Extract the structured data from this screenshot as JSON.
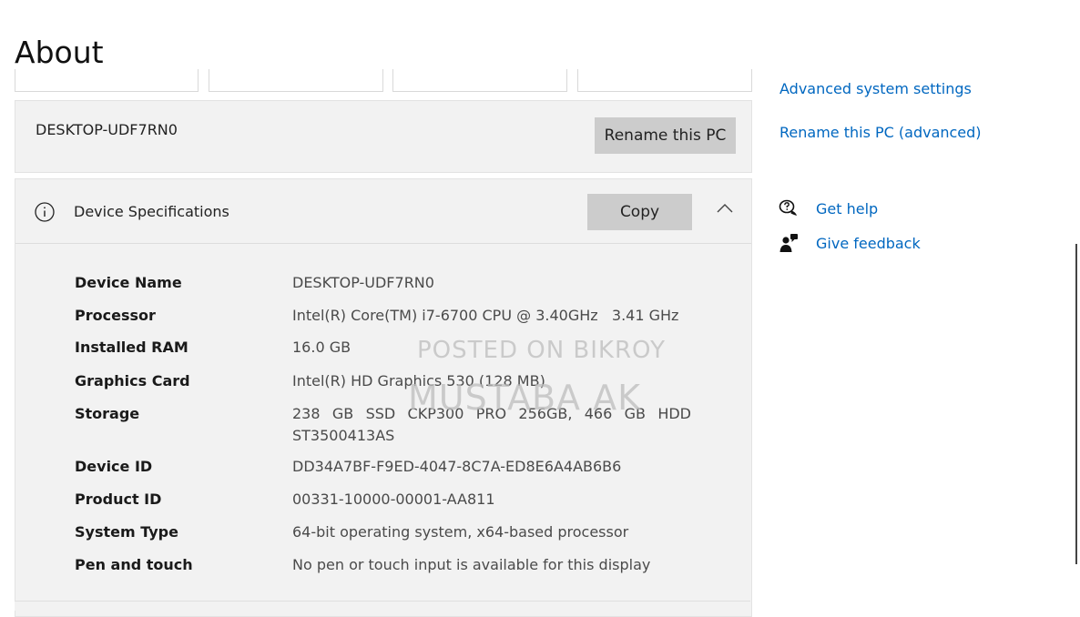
{
  "page": {
    "title": "About"
  },
  "rename": {
    "pc_name": "DESKTOP-UDF7RN0",
    "button_label": "Rename this PC"
  },
  "specs": {
    "title": "Device Specifications",
    "copy_label": "Copy",
    "rows": [
      {
        "label": "Device Name",
        "value": "DESKTOP-UDF7RN0"
      },
      {
        "label": "Processor",
        "value": "Intel(R) Core(TM) i7-6700 CPU @ 3.40GHz   3.41 GHz"
      },
      {
        "label": "Installed RAM",
        "value": "16.0 GB"
      },
      {
        "label": "Graphics Card",
        "value": "Intel(R) HD Graphics 530 (128 MB)"
      },
      {
        "label": "Storage",
        "value": "238 GB SSD CKP300 PRO 256GB, 466 GB HDD ST3500413AS"
      },
      {
        "label": "Device ID",
        "value": "DD34A7BF-F9ED-4047-8C7A-ED8E6A4AB6B6"
      },
      {
        "label": "Product ID",
        "value": "00331-10000-00001-AA811"
      },
      {
        "label": "System Type",
        "value": "64-bit operating system, x64-based processor"
      },
      {
        "label": "Pen and touch",
        "value": "No pen or touch input is available for this display"
      }
    ]
  },
  "watermark": {
    "line1": "POSTED ON BIKROY",
    "line2": "MUSTABA AK"
  },
  "related": {
    "advanced_system_settings": "Advanced system settings",
    "rename_advanced": "Rename this PC (advanced)"
  },
  "support": {
    "get_help": "Get help",
    "give_feedback": "Give feedback"
  },
  "icons": {
    "info": "info-icon",
    "chevron": "chevron-up-icon",
    "help": "get-help-icon",
    "feedback": "give-feedback-icon"
  },
  "colors": {
    "link": "#0067c0",
    "panel": "#f2f2f2",
    "button": "#cccccc"
  }
}
